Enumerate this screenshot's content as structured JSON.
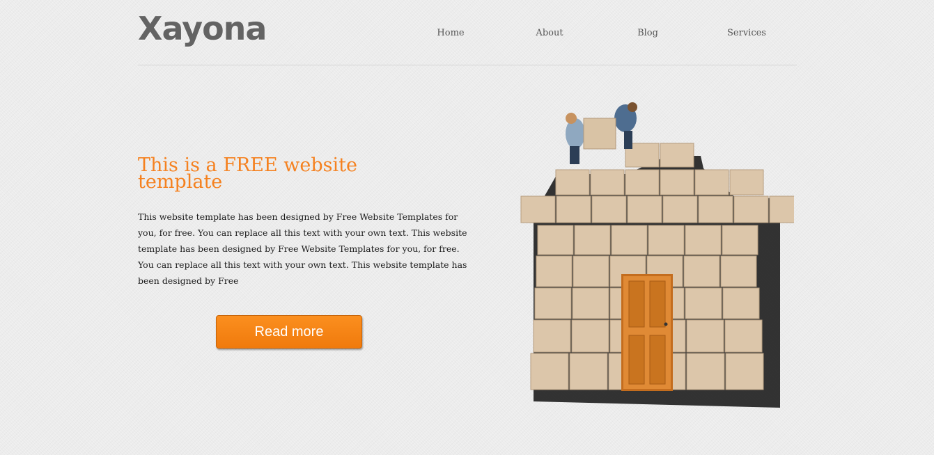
{
  "header": {
    "logo": "Xayona",
    "nav": [
      {
        "label": "Home"
      },
      {
        "label": "About"
      },
      {
        "label": "Blog"
      },
      {
        "label": "Services"
      }
    ]
  },
  "main": {
    "headline": "This is a FREE website template",
    "body": "This website template has been designed by Free Website Templates for you, for free. You can replace all this text with your own text. This website template has been designed by Free Website Templates for you, for free. You can replace all this text with your own text. This website template has been designed by Free",
    "cta_label": "Read more"
  },
  "hero": {
    "subject": "box-house-illustration",
    "colors": {
      "box": "#dcc6aa",
      "box_edge": "#b69d80",
      "door": "#d9822e",
      "shadow": "#1e1e1e"
    }
  },
  "theme": {
    "accent": "#f5811f",
    "background": "#ececec",
    "logo_color": "#636363",
    "nav_color": "#555555"
  }
}
